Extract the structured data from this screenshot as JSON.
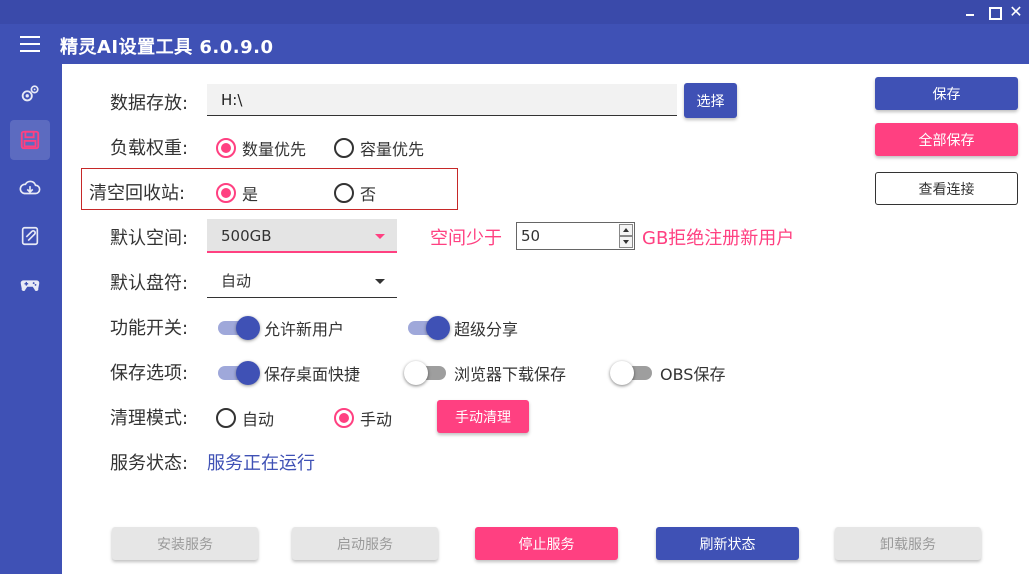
{
  "app": {
    "title": "精灵AI设置工具 6.0.9.0"
  },
  "window_controls": [
    "minimize",
    "maximize",
    "close"
  ],
  "sidebar": {
    "items": [
      {
        "icon": "settings-icon"
      },
      {
        "icon": "save-disk-icon",
        "active": true
      },
      {
        "icon": "cloud-download-icon"
      },
      {
        "icon": "document-icon"
      },
      {
        "icon": "gamepad-icon"
      }
    ]
  },
  "form": {
    "data_storage": {
      "label": "数据存放:",
      "value": "H:\\",
      "button": "选择"
    },
    "load_weight": {
      "label": "负载权重:",
      "options": [
        "数量优先",
        "容量优先"
      ],
      "selected": "数量优先"
    },
    "recycle_bin": {
      "label": "清空回收站:",
      "options": [
        "是",
        "否"
      ],
      "selected": "是"
    },
    "default_space": {
      "label": "默认空间:",
      "value": "500GB",
      "prefix": "空间少于",
      "threshold": "50",
      "suffix": "GB拒绝注册新用户"
    },
    "default_drive": {
      "label": "默认盘符:",
      "value": "自动"
    },
    "feature_switch": {
      "label": "功能开关:",
      "toggles": [
        {
          "label": "允许新用户",
          "on": true
        },
        {
          "label": "超级分享",
          "on": true
        }
      ]
    },
    "save_options": {
      "label": "保存选项:",
      "toggles": [
        {
          "label": "保存桌面快捷",
          "on": true
        },
        {
          "label": "浏览器下载保存",
          "on": false
        },
        {
          "label": "OBS保存",
          "on": false
        }
      ]
    },
    "clean_mode": {
      "label": "清理模式:",
      "options": [
        "自动",
        "手动"
      ],
      "selected": "手动",
      "button": "手动清理"
    },
    "service_status": {
      "label": "服务状态:",
      "value": "服务正在运行"
    }
  },
  "right_panel": {
    "save": "保存",
    "save_all": "全部保存",
    "view_connections": "查看连接"
  },
  "bottom_buttons": {
    "install": "安装服务",
    "start": "启动服务",
    "stop": "停止服务",
    "refresh": "刷新状态",
    "uninstall": "卸载服务"
  },
  "colors": {
    "primary": "#3f51b5",
    "accent": "#ff4081",
    "highlight_border": "#c62828"
  }
}
